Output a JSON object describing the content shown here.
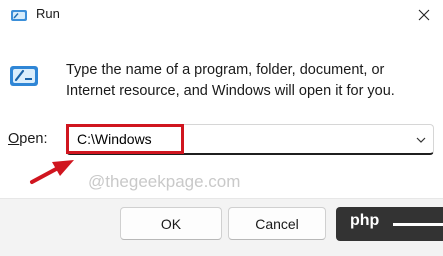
{
  "window": {
    "title": "Run"
  },
  "content": {
    "description": "Type the name of a program, folder, document, or Internet resource, and Windows will open it for you."
  },
  "open": {
    "label_underlined": "O",
    "label_rest": "pen:",
    "value": "C:\\Windows"
  },
  "watermark": "@thegeekpage.com",
  "buttons": {
    "ok": "OK",
    "cancel": "Cancel"
  },
  "badge": {
    "text": "php"
  },
  "colors": {
    "highlight": "#d0151f",
    "footer": "#f3f3f3"
  },
  "icons": [
    "run-app-icon",
    "close-icon",
    "run-program-icon",
    "chevron-down-icon",
    "arrow-annotation-icon"
  ]
}
